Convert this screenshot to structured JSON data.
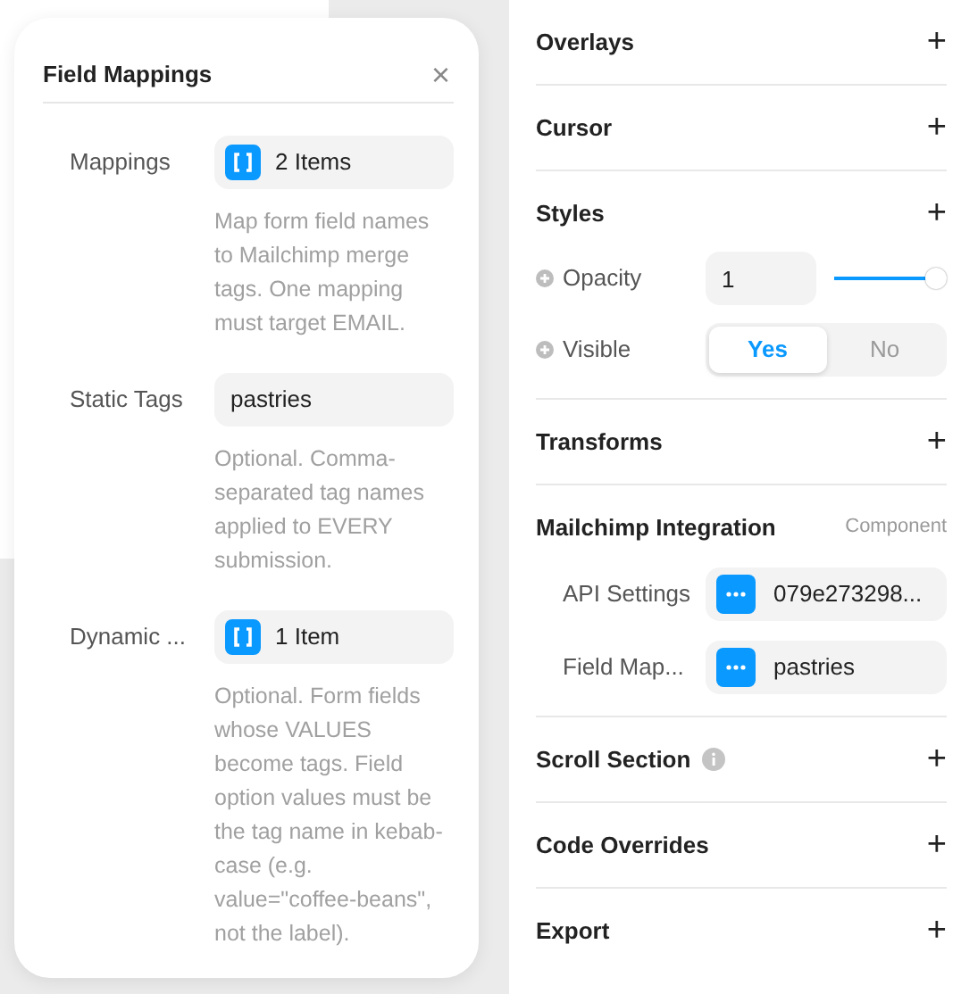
{
  "popover": {
    "title": "Field Mappings",
    "close": "×",
    "fields": [
      {
        "label": "Mappings",
        "kind": "array",
        "value": "2 Items",
        "description": "Map form field names to Mailchimp merge tags. One mapping must target EMAIL."
      },
      {
        "label": "Static Tags",
        "kind": "text",
        "value": "pastries",
        "description": "Optional. Comma-separated tag names applied to EVERY submission."
      },
      {
        "label": "Dynamic ...",
        "kind": "array",
        "value": "1 Item",
        "description": "Optional. Form fields whose VALUES become tags. Field option values must be the tag name in kebab-case (e.g. value=\"coffee-beans\", not the label)."
      }
    ]
  },
  "sections": [
    {
      "title": "Overlays",
      "action": "+"
    },
    {
      "title": "Cursor",
      "action": "+"
    },
    {
      "title": "Styles",
      "action": "+",
      "rows": [
        {
          "kind": "number-slider",
          "label": "Opacity",
          "value": "1",
          "level": 1
        },
        {
          "kind": "segmented",
          "label": "Visible",
          "options": [
            {
              "label": "Yes",
              "selected": true
            },
            {
              "label": "No",
              "selected": false
            }
          ]
        }
      ]
    },
    {
      "title": "Transforms",
      "action": "+"
    },
    {
      "title": "Mailchimp Integration",
      "badge": "Component",
      "rows": [
        {
          "kind": "link-field",
          "label": "API Settings",
          "value": "079e273298..."
        },
        {
          "kind": "link-field",
          "label": "Field Map...",
          "value": "pastries"
        }
      ]
    },
    {
      "title": "Scroll Section",
      "info": true,
      "action": "+"
    },
    {
      "title": "Code Overrides",
      "action": "+"
    },
    {
      "title": "Export",
      "action": "+"
    }
  ]
}
